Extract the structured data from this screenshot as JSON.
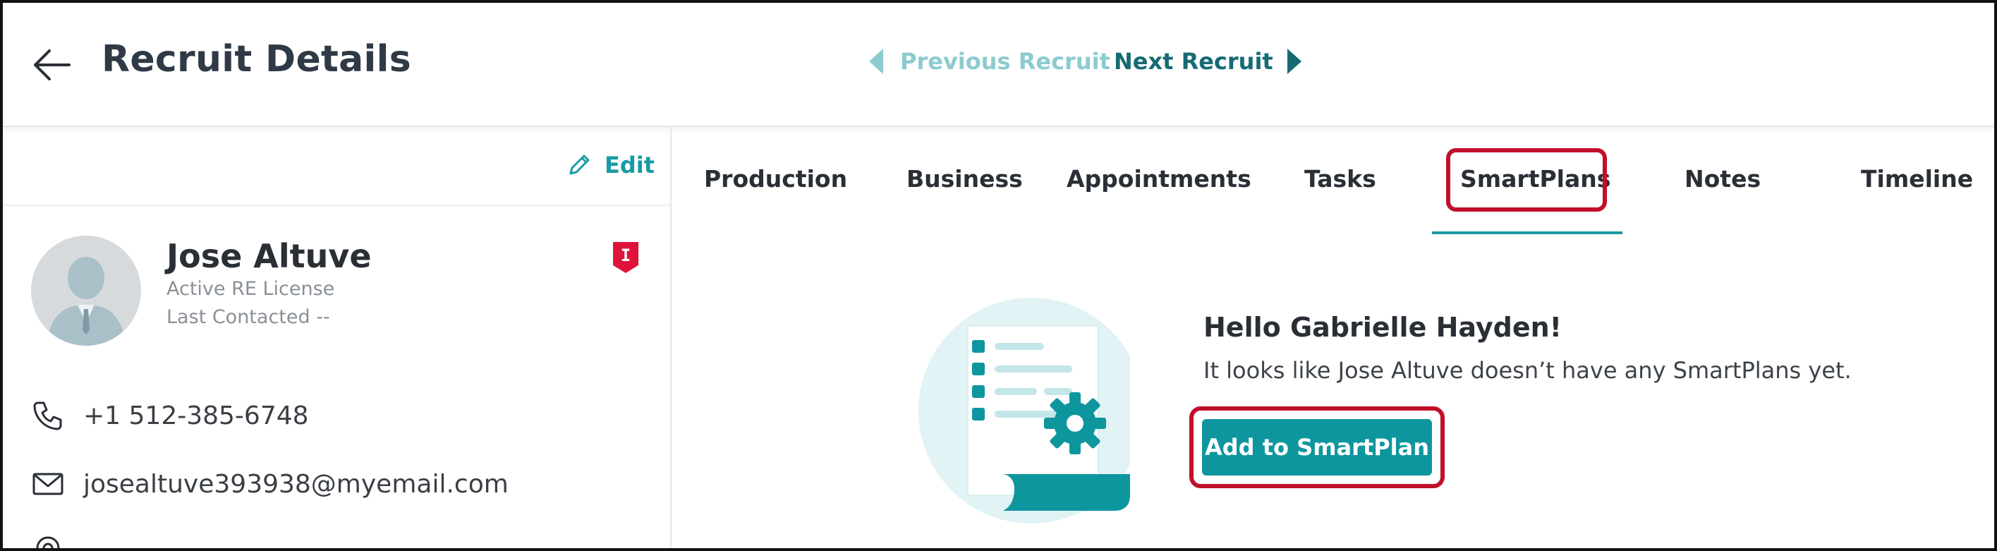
{
  "header": {
    "title": "Recruit Details",
    "prev_label": "Previous Recruit",
    "next_label": "Next Recruit"
  },
  "profile": {
    "edit_label": "Edit",
    "name": "Jose Altuve",
    "license_status": "Active RE License",
    "last_contacted": "Last Contacted --",
    "badge_letter": "I",
    "phone": "+1 512-385-6748",
    "email": "josealtuve393938@myemail.com"
  },
  "tabs": [
    {
      "label": "Production"
    },
    {
      "label": "Business"
    },
    {
      "label": "Appointments"
    },
    {
      "label": "Tasks"
    },
    {
      "label": "SmartPlans",
      "active": true
    },
    {
      "label": "Notes"
    },
    {
      "label": "Timeline"
    }
  ],
  "empty_state": {
    "greeting": "Hello Gabrielle Hayden!",
    "message": "It looks like Jose Altuve doesn’t have any SmartPlans yet.",
    "cta_label": "Add to SmartPlan"
  },
  "colors": {
    "accent": "#1a9aa5",
    "cta_bg": "#0e969f",
    "highlight": "#c0102a",
    "badge": "#e0123a"
  },
  "icons": [
    "back-arrow-icon",
    "chevron-left-icon",
    "chevron-right-icon",
    "pencil-icon",
    "badge-icon",
    "phone-icon",
    "mail-icon",
    "location-icon",
    "smartplan-illustration"
  ]
}
